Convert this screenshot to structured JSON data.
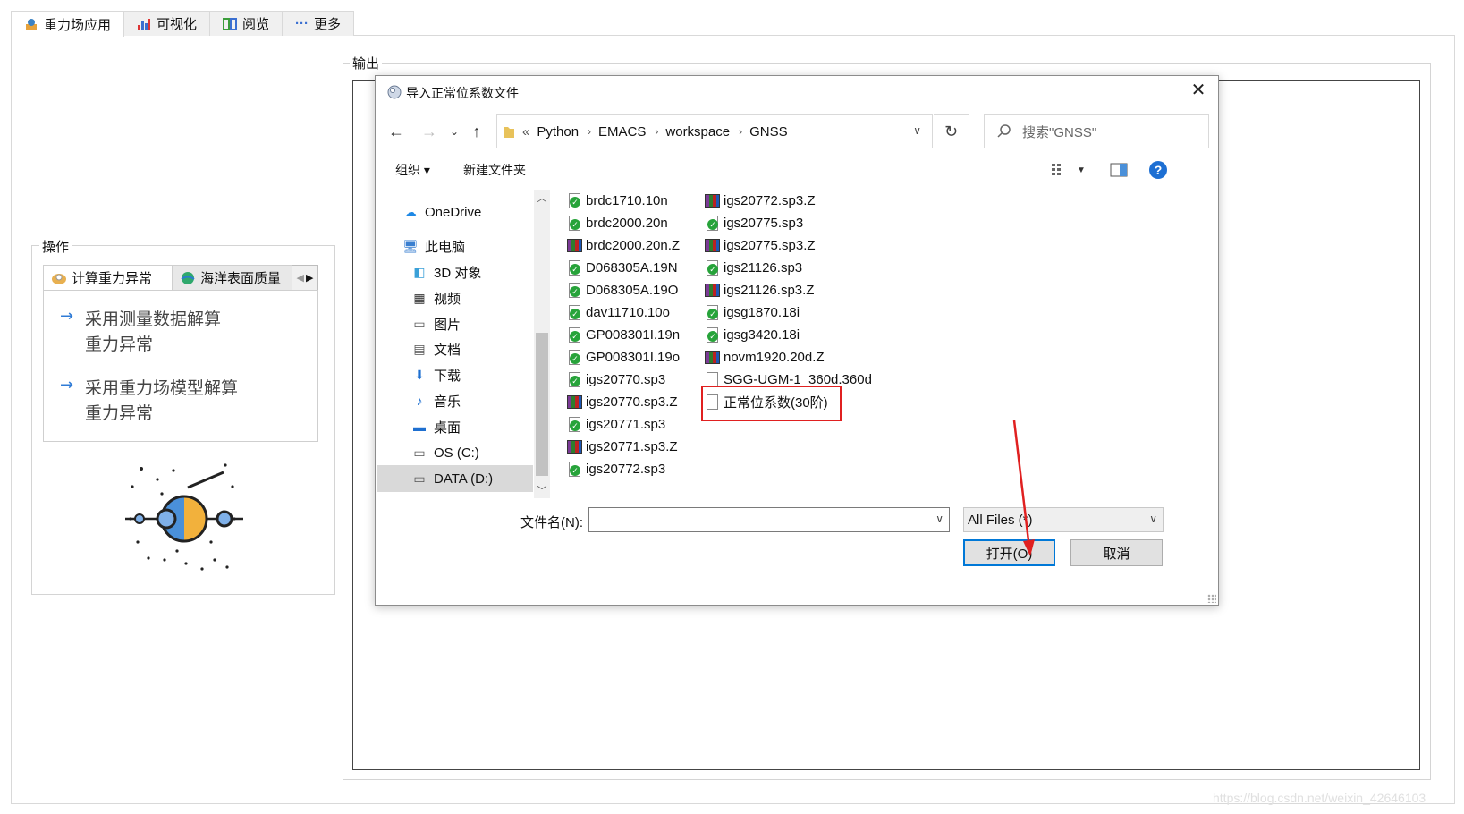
{
  "app_tabs": [
    {
      "label": "重力场应用",
      "icon": "gravity-app-icon"
    },
    {
      "label": "可视化",
      "icon": "bar-chart-icon"
    },
    {
      "label": "阅览",
      "icon": "browse-icon"
    },
    {
      "label": "更多",
      "icon": "more-dots-icon"
    }
  ],
  "output_group": {
    "legend": "输出"
  },
  "operation_group": {
    "legend": "操作",
    "tabs": [
      {
        "label": "计算重力异常",
        "icon": "calc-gravity-icon"
      },
      {
        "label": "海洋表面质量",
        "icon": "ocean-surface-icon"
      }
    ],
    "links": [
      {
        "line1": "采用测量数据解算",
        "line2": "重力异常"
      },
      {
        "line1": "采用重力场模型解算",
        "line2": "重力异常"
      }
    ]
  },
  "dialog": {
    "title": "导入正常位系数文件",
    "close": "✕",
    "breadcrumb_prefix": "«",
    "breadcrumb": [
      "Python",
      "EMACS",
      "workspace",
      "GNSS"
    ],
    "search_placeholder": "搜索\"GNSS\"",
    "toolbar": {
      "organize": "组织 ▾",
      "new_folder": "新建文件夹"
    },
    "nav_items": [
      {
        "label": "OneDrive",
        "icon": "cloud-icon",
        "indent": 0,
        "selected": false
      },
      {
        "label": "此电脑",
        "icon": "computer-icon",
        "indent": 0,
        "selected": false
      },
      {
        "label": "3D 对象",
        "icon": "3d-objects-icon",
        "indent": 1,
        "selected": false
      },
      {
        "label": "视频",
        "icon": "video-icon",
        "indent": 1,
        "selected": false
      },
      {
        "label": "图片",
        "icon": "pictures-icon",
        "indent": 1,
        "selected": false
      },
      {
        "label": "文档",
        "icon": "documents-icon",
        "indent": 1,
        "selected": false
      },
      {
        "label": "下载",
        "icon": "download-icon",
        "indent": 1,
        "selected": false
      },
      {
        "label": "音乐",
        "icon": "music-icon",
        "indent": 1,
        "selected": false
      },
      {
        "label": "桌面",
        "icon": "desktop-icon",
        "indent": 1,
        "selected": false
      },
      {
        "label": "OS (C:)",
        "icon": "drive-icon",
        "indent": 1,
        "selected": false
      },
      {
        "label": "DATA (D:)",
        "icon": "drive-icon",
        "indent": 1,
        "selected": true
      }
    ],
    "files_col1": [
      {
        "name": "brdc1710.10n",
        "type": "check"
      },
      {
        "name": "brdc2000.20n",
        "type": "check"
      },
      {
        "name": "brdc2000.20n.Z",
        "type": "zip"
      },
      {
        "name": "D068305A.19N",
        "type": "check"
      },
      {
        "name": "D068305A.19O",
        "type": "check"
      },
      {
        "name": "dav11710.10o",
        "type": "check"
      },
      {
        "name": "GP008301I.19n",
        "type": "check"
      },
      {
        "name": "GP008301I.19o",
        "type": "check"
      },
      {
        "name": "igs20770.sp3",
        "type": "check"
      },
      {
        "name": "igs20770.sp3.Z",
        "type": "zip"
      },
      {
        "name": "igs20771.sp3",
        "type": "check"
      },
      {
        "name": "igs20771.sp3.Z",
        "type": "zip"
      },
      {
        "name": "igs20772.sp3",
        "type": "check"
      }
    ],
    "files_col2": [
      {
        "name": "igs20772.sp3.Z",
        "type": "zip"
      },
      {
        "name": "igs20775.sp3",
        "type": "check"
      },
      {
        "name": "igs20775.sp3.Z",
        "type": "zip"
      },
      {
        "name": "igs21126.sp3",
        "type": "check"
      },
      {
        "name": "igs21126.sp3.Z",
        "type": "zip"
      },
      {
        "name": "igsg1870.18i",
        "type": "check"
      },
      {
        "name": "igsg3420.18i",
        "type": "check"
      },
      {
        "name": "novm1920.20d.Z",
        "type": "zip"
      },
      {
        "name": "SGG-UGM-1_360d.360d",
        "type": "doc"
      },
      {
        "name": "正常位系数(30阶)",
        "type": "doc"
      }
    ],
    "filename_label": "文件名(N):",
    "filename_value": "",
    "filetype_value": "All Files (*)",
    "open_button": "打开(O)",
    "cancel_button": "取消"
  },
  "watermark": "https://blog.csdn.net/weixin_42646103",
  "colors": {
    "accent": "#0078d7",
    "highlight": "#e02020",
    "link_arrow": "#2f7bd6"
  }
}
